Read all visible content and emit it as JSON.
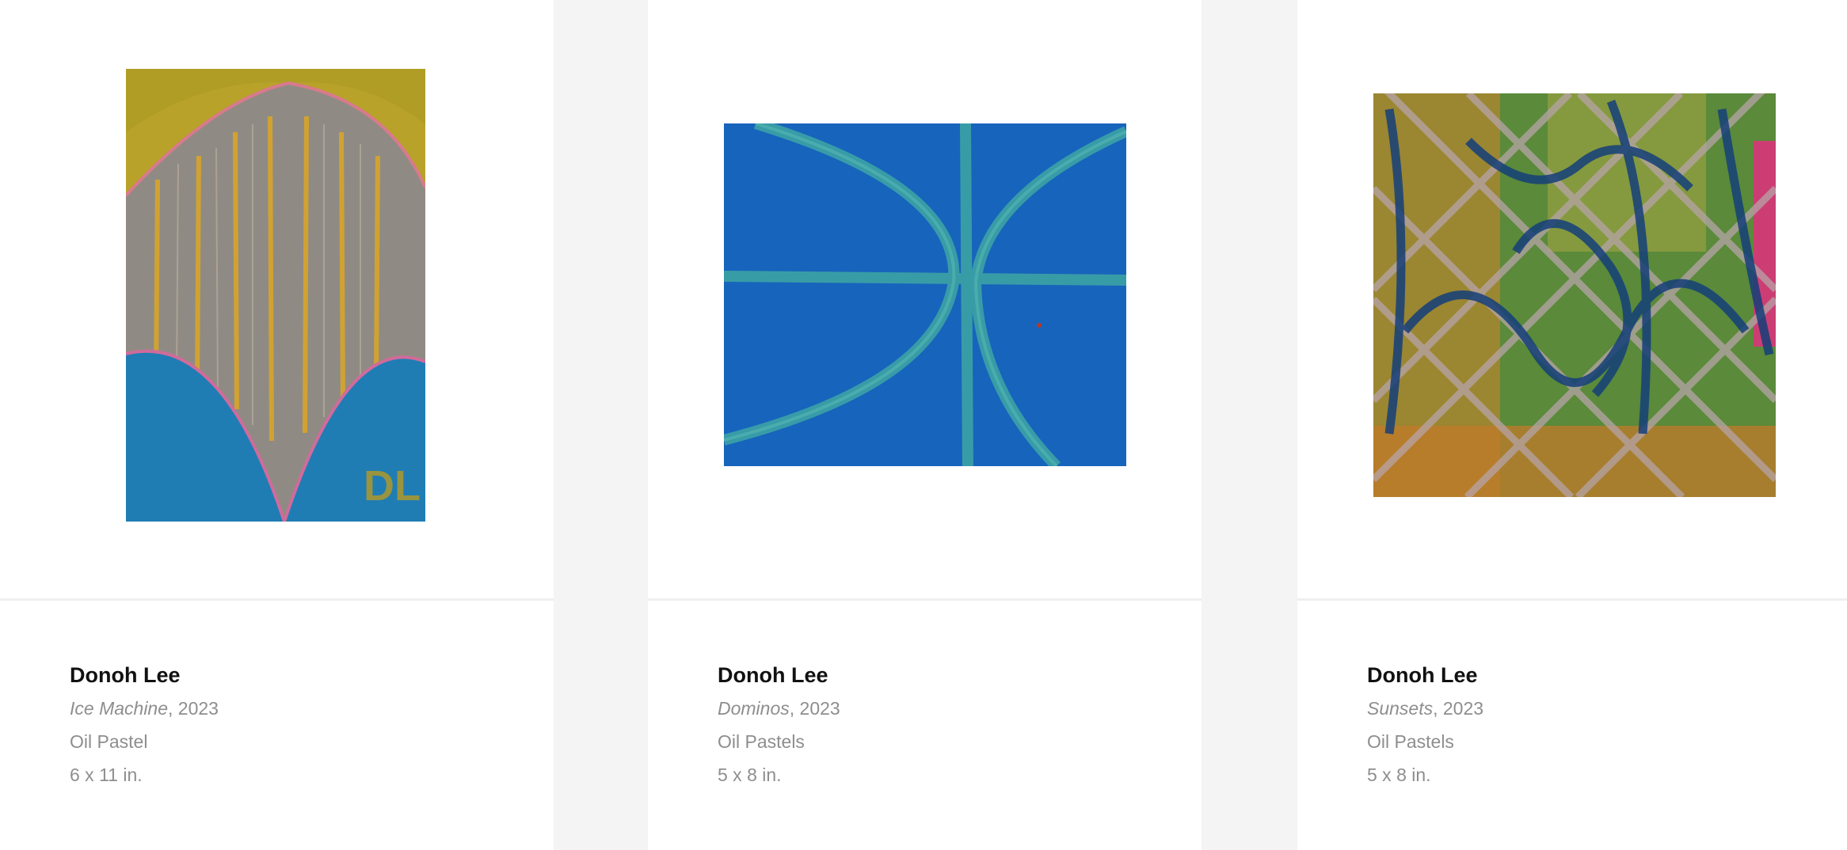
{
  "artworks": [
    {
      "artist": "Donoh Lee",
      "title": "Ice Machine",
      "year_suffix": ", 2023",
      "medium": "Oil Pastel",
      "dimensions": "6 x 11 in.",
      "colors": {
        "top": "#b8a22a",
        "middle": "#8f8b84",
        "bottom": "#1f7db4",
        "accent": "#d9a52a"
      }
    },
    {
      "artist": "Donoh Lee",
      "title": "Dominos",
      "year_suffix": ", 2023",
      "medium": "Oil Pastels",
      "dimensions": "5 x 8 in.",
      "colors": {
        "base": "#1460b8",
        "lines": "#3ea6a4"
      }
    },
    {
      "artist": "Donoh Lee",
      "title": "Sunsets",
      "year_suffix": ", 2023",
      "medium": "Oil Pastels",
      "dimensions": "5 x 8 in.",
      "colors": {
        "base": "#5a8a3a",
        "warm": "#d2832a",
        "dark": "#153f7a",
        "lattice": "#b7a4a8",
        "pink": "#d8357a"
      }
    }
  ]
}
